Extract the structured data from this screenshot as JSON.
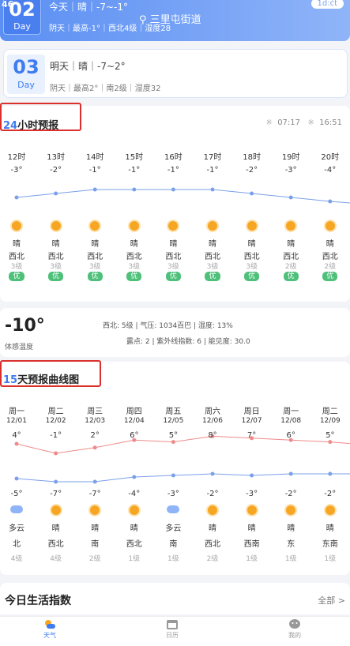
{
  "today": {
    "status_corner": "46",
    "day_num": "02",
    "day_label": "Day",
    "line1": "今天｜晴｜-7~-1°",
    "line2": "阴天｜最高-1°｜西北4级｜湿度28",
    "location": "三里屯街道",
    "badge": "1d:ċṫ"
  },
  "tomorrow": {
    "day_num": "03",
    "day_label": "Day",
    "line1": "明天｜晴｜-7~2°",
    "line2": "阴天｜最高2°｜南2级｜湿度32"
  },
  "hourly": {
    "title_hl": "24",
    "title_rest": "小时预报",
    "sunrise": "07:17",
    "sunset": "16:51",
    "items": [
      {
        "time": "12时",
        "temp": "-3°",
        "t": -3,
        "cond": "晴",
        "wind": "西北",
        "level": "3级",
        "aq": "优"
      },
      {
        "time": "13时",
        "temp": "-2°",
        "t": -2,
        "cond": "晴",
        "wind": "西北",
        "level": "3级",
        "aq": "优"
      },
      {
        "time": "14时",
        "temp": "-1°",
        "t": -1,
        "cond": "晴",
        "wind": "西北",
        "level": "3级",
        "aq": "优"
      },
      {
        "time": "15时",
        "temp": "-1°",
        "t": -1,
        "cond": "晴",
        "wind": "西北",
        "level": "3级",
        "aq": "优"
      },
      {
        "time": "16时",
        "temp": "-1°",
        "t": -1,
        "cond": "晴",
        "wind": "西北",
        "level": "3级",
        "aq": "优"
      },
      {
        "time": "17时",
        "temp": "-1°",
        "t": -1,
        "cond": "晴",
        "wind": "西北",
        "level": "3级",
        "aq": "优"
      },
      {
        "time": "18时",
        "temp": "-2°",
        "t": -2,
        "cond": "晴",
        "wind": "西北",
        "level": "3级",
        "aq": "优"
      },
      {
        "time": "19时",
        "temp": "-3°",
        "t": -3,
        "cond": "晴",
        "wind": "西北",
        "level": "2级",
        "aq": "优"
      },
      {
        "time": "20时",
        "temp": "-4°",
        "t": -4,
        "cond": "晴",
        "wind": "西北",
        "level": "2级",
        "aq": "优"
      }
    ]
  },
  "now": {
    "temp": "-10°",
    "feel_label": "体感温度",
    "line1": "西北: 5级 | 气压: 1034百巴 | 湿度: 13%",
    "line2": "露点: 2 | 紫外线指数: 6 | 能见度: 30.0"
  },
  "forecast": {
    "title_hl": "15",
    "title_rest": "天预报曲线图",
    "items": [
      {
        "wd": "周一",
        "date": "12/01",
        "high": "4°",
        "h": 4,
        "low": "-5°",
        "l": -5,
        "cond": "多云",
        "icon": "cloud",
        "dir": "北",
        "level": "4级"
      },
      {
        "wd": "周二",
        "date": "12/02",
        "high": "-1°",
        "h": -1,
        "low": "-7°",
        "l": -7,
        "cond": "晴",
        "icon": "sun",
        "dir": "西北",
        "level": "4级"
      },
      {
        "wd": "周三",
        "date": "12/03",
        "high": "2°",
        "h": 2,
        "low": "-7°",
        "l": -7,
        "cond": "晴",
        "icon": "sun",
        "dir": "南",
        "level": "2级"
      },
      {
        "wd": "周四",
        "date": "12/04",
        "high": "6°",
        "h": 6,
        "low": "-4°",
        "l": -4,
        "cond": "晴",
        "icon": "sun",
        "dir": "西北",
        "level": "1级"
      },
      {
        "wd": "周五",
        "date": "12/05",
        "high": "5°",
        "h": 5,
        "low": "-3°",
        "l": -3,
        "cond": "多云",
        "icon": "cloud",
        "dir": "南",
        "level": "1级"
      },
      {
        "wd": "周六",
        "date": "12/06",
        "high": "8°",
        "h": 8,
        "low": "-2°",
        "l": -2,
        "cond": "晴",
        "icon": "sun",
        "dir": "西北",
        "level": "2级"
      },
      {
        "wd": "周日",
        "date": "12/07",
        "high": "7°",
        "h": 7,
        "low": "-3°",
        "l": -3,
        "cond": "晴",
        "icon": "sun",
        "dir": "西南",
        "level": "1级"
      },
      {
        "wd": "周一",
        "date": "12/08",
        "high": "6°",
        "h": 6,
        "low": "-2°",
        "l": -2,
        "cond": "晴",
        "icon": "sun",
        "dir": "东",
        "level": "1级"
      },
      {
        "wd": "周二",
        "date": "12/09",
        "high": "5°",
        "h": 5,
        "low": "-2°",
        "l": -2,
        "cond": "晴",
        "icon": "sun",
        "dir": "东南",
        "level": "1级"
      }
    ]
  },
  "life": {
    "title": "今日生活指数",
    "all": "全部 >"
  },
  "tabs": [
    {
      "label": "天气",
      "icon": "weather-icon",
      "active": true
    },
    {
      "label": "日历",
      "icon": "calendar-icon",
      "active": false
    },
    {
      "label": "我的",
      "icon": "profile-icon",
      "active": false
    }
  ],
  "colors": {
    "accent": "#3f7cf0",
    "high_line": "#f08a8a",
    "low_line": "#7aa0ea",
    "aq_good": "#4ec07a",
    "highlight_box": "#d9302c"
  }
}
